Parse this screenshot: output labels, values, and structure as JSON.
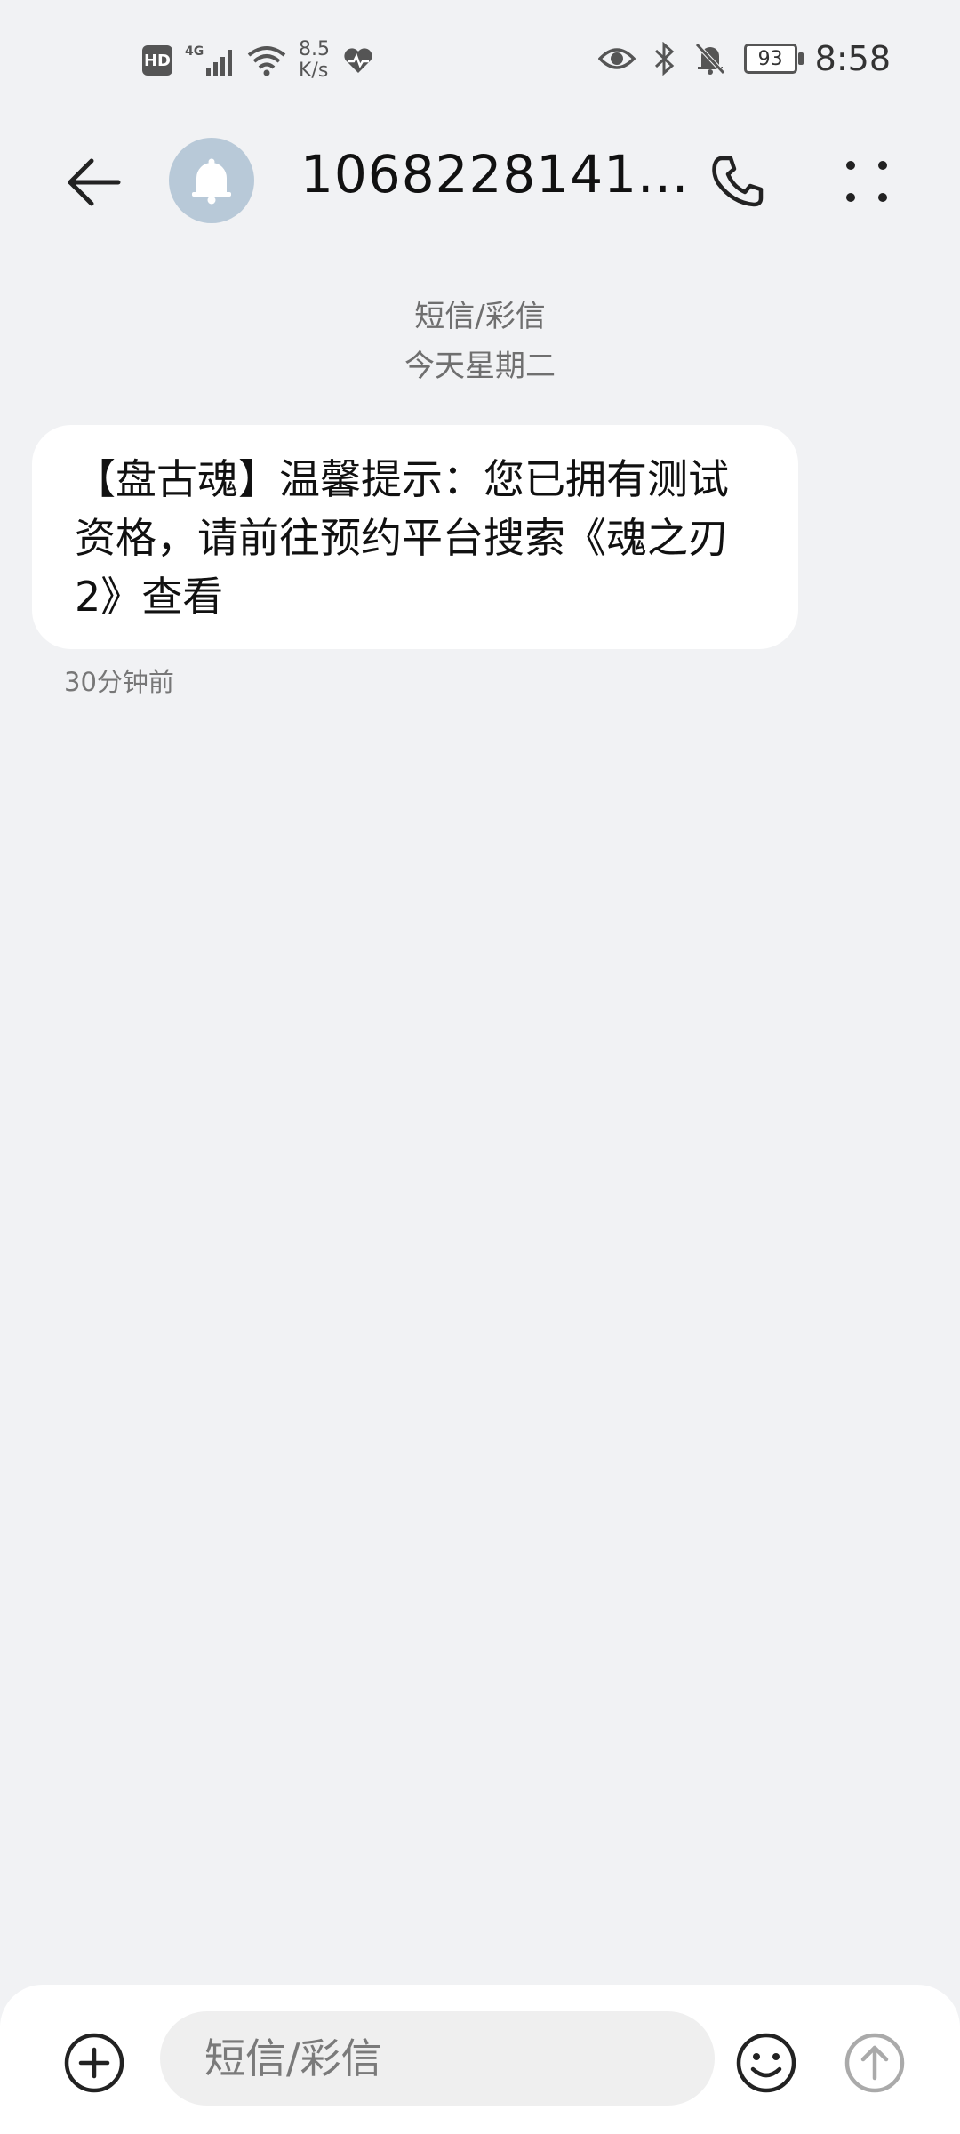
{
  "status_bar": {
    "hd_label": "HD",
    "network_label": "4G",
    "speed_value": "8.5",
    "speed_unit": "K/s",
    "battery_level": "93",
    "time": "8:58",
    "icons": [
      "hd-icon",
      "signal-icon",
      "wifi-icon",
      "health-icon",
      "eye-icon",
      "bluetooth-icon",
      "mute-bell-icon",
      "battery-icon"
    ]
  },
  "app_bar": {
    "contact_name": "1068228141...",
    "icons": [
      "back-arrow-icon",
      "bell-avatar-icon",
      "phone-icon",
      "more-dots-icon"
    ]
  },
  "conversation": {
    "channel_label": "短信/彩信",
    "date_label": "今天星期二",
    "messages": [
      {
        "text": "【盘古魂】温馨提示：您已拥有测试资格，请前往预约平台搜索《魂之刃2》查看",
        "time": "30分钟前"
      }
    ]
  },
  "composer": {
    "placeholder": "短信/彩信",
    "icons": [
      "add-icon",
      "emoji-icon",
      "send-arrow-icon"
    ]
  },
  "colors": {
    "background": "#f1f2f4",
    "bubble": "#ffffff",
    "avatar": "#b8c9d8"
  }
}
